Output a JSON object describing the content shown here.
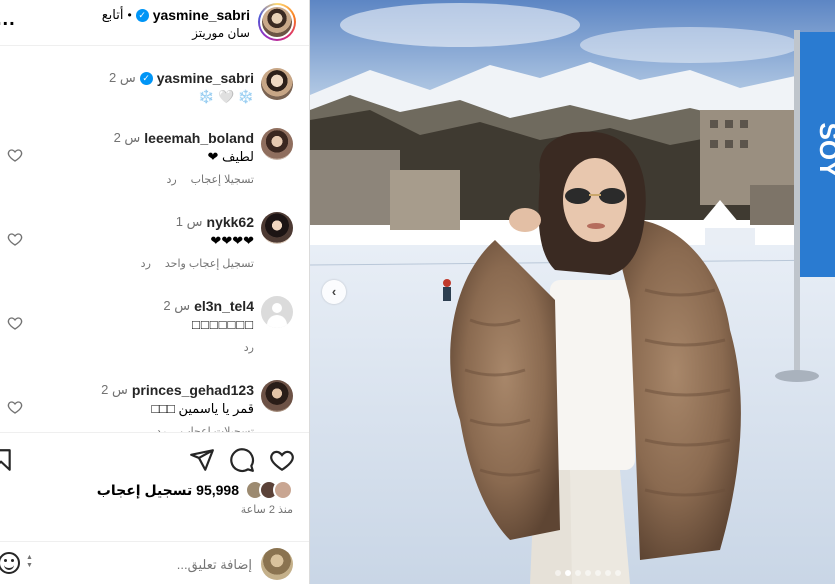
{
  "header": {
    "username": "yasmine_sabri",
    "follow_label": "أتابع",
    "separator": "•",
    "location": "سان موريتز",
    "more_label": "..."
  },
  "comments": [
    {
      "username": "yasmine_sabri",
      "verified": true,
      "time": "2 س",
      "text": "❄️ 🤍 ❄️",
      "reply": "",
      "likes_label": ""
    },
    {
      "username": "leeemah_boland",
      "verified": false,
      "time": "2 س",
      "text": "لطيف ❤",
      "likes_label": "تسجيلا إعجاب",
      "reply": "رد"
    },
    {
      "username": "nykk62",
      "verified": false,
      "time": "1 س",
      "text": "❤❤❤❤",
      "likes_label": "تسجيل إعجاب واحد",
      "reply": "رد"
    },
    {
      "username": "el3n_tel4",
      "verified": false,
      "time": "2 س",
      "text": "□□□□□□□",
      "likes_label": "",
      "reply": "رد"
    },
    {
      "username": "princes_gehad123",
      "verified": false,
      "time": "2 س",
      "text": "قمر يا ياسمين □□□",
      "likes_label": "تسجيلات إعجاب",
      "reply": "رد"
    }
  ],
  "actions": {
    "likes_count": "95,998",
    "likes_label": "تسجيل إعجاب",
    "time_ago": "منذ 2 ساعة",
    "comment_placeholder": "إضافة تعليق..."
  },
  "media": {
    "prev_label": "‹",
    "banner_text": "SOY",
    "slide_count": 7,
    "active_slide": 1
  },
  "colors": {
    "verified": "#0095f6",
    "secondary_text": "#737373",
    "border": "#dbdbdb"
  }
}
